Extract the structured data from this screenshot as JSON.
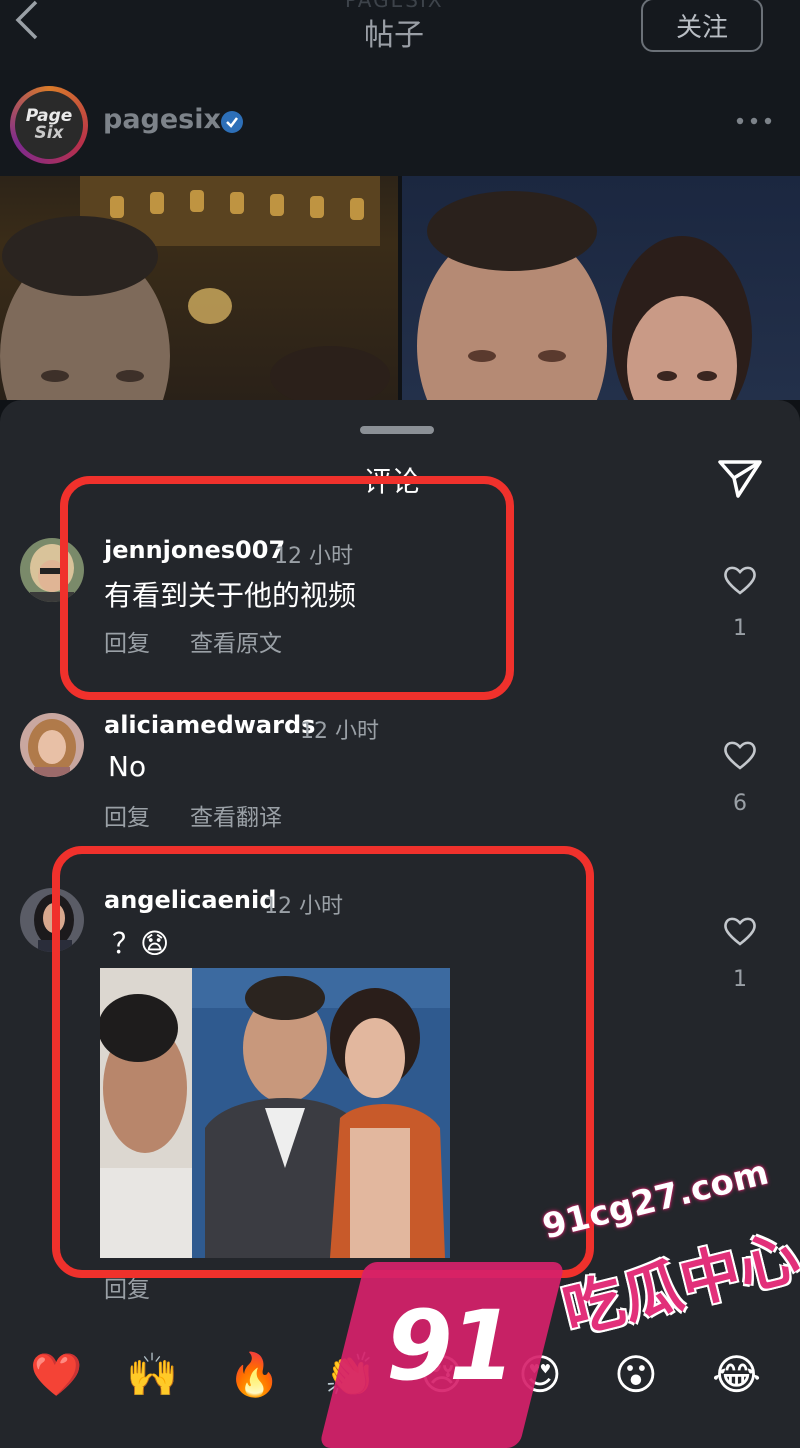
{
  "header": {
    "ghost_title": "PAGESIX",
    "title": "帖子",
    "follow_label": "关注"
  },
  "post": {
    "username": "pagesix",
    "logo_text_1": "Page",
    "logo_text_2": "Six"
  },
  "comments_sheet": {
    "title": "评论",
    "comments": [
      {
        "username": "jennjones007",
        "time": "12 小时",
        "text": "有看到关于他的视频",
        "reply_label": "回复",
        "extra_label": "查看原文",
        "likes": "1"
      },
      {
        "username": "aliciamedwards",
        "time": "12 小时",
        "text": "No",
        "reply_label": "回复",
        "extra_label": "查看翻译",
        "likes": "6"
      },
      {
        "username": "angelicaenid",
        "time": "12 小时",
        "text": "？😧",
        "reply_label": "回复",
        "likes": "1"
      }
    ]
  },
  "emoji_bar": [
    "❤️",
    "🙌",
    "🔥",
    "👏",
    "😢",
    "😍",
    "😮",
    "😂"
  ],
  "watermark": {
    "number": "91",
    "url": "91cg27.com",
    "text": "吃瓜中心"
  },
  "colors": {
    "background": "#0f1216",
    "sheet": "#23262b",
    "highlight": "#f0312c",
    "watermark": "#d6216a"
  }
}
